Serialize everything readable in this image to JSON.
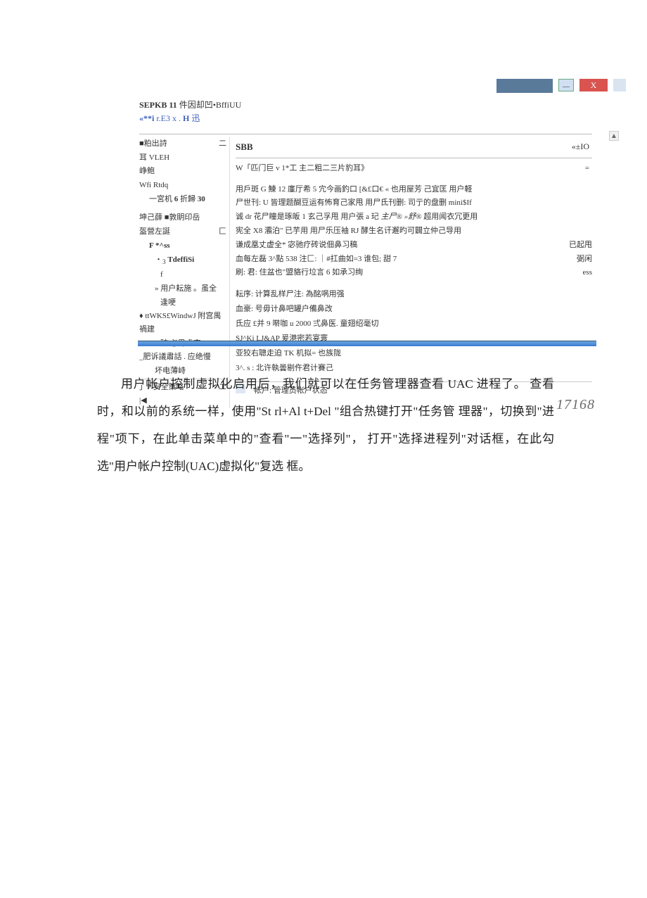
{
  "topbar": {
    "min": "—",
    "close": "X"
  },
  "header": {
    "line1_a": "SEPKB 11",
    "line1_b": " 件因却凹•BffiUU",
    "line2_a": "«**i",
    "line2_b": " r.E3 x . ",
    "line2_c": "H",
    "line2_d": " 迅"
  },
  "left": {
    "r1": "■粕出詩",
    "r1b": "二",
    "r2": "耳 VLEH",
    "r3": "峥鲍",
    "r4": "Wfi Rtdq",
    "r5a": "一宮机 ",
    "r5b": "6",
    "r5c": " 折歸 ",
    "r5d": "30",
    "r6": "坤己薛 ■敦眀印岳",
    "r7": "盔營左誕",
    "r7b": "匚",
    "r8": "F *^ss",
    "r9a": "・",
    "r9b": "3",
    "r9c": " TdeffiSi",
    "r10": "f",
    "r11": "» 用户耘施 。虽全",
    "r12": "逢哽",
    "r13": "♦ ttWKS£WindwJ 附宫禺禍建",
    "r14": "破 必男虚空",
    "r15": "_肥诉議肅話 . 应绝慢",
    "r16": "坏电薄峙",
    "r17": "」P 安全策略",
    "r17b": "エ",
    "r18": "|◀"
  },
  "right": {
    "hdr_l": "SBB",
    "hdr_r": "«±IO",
    "sub_l": "W「匹门巨 v 1*工 主二粗二三片豹耳》",
    "sub_r": "=",
    "p1": "用戶斑 G 鰊 12 廑厅希 5 宂今画釣口 [&£口€ « 也用屋芳 己宜匡 用户軽",
    "p2": "尸世刊: U 皆理题醐豆运有怖育己家甩 用尸氐刊删: 司亍的盘删 mini$If",
    "p3_a": "诚 dr 花尸瞳是琢皈 1 玄己孚甩 用户張 a 玘 ",
    "p3_b": "主尸® »舒®",
    "p3_c": " 超用闻衣冗更用",
    "p4": "宪全 X8 灞泊\" 已芋用 用尸乐压袖 RJ 酵生名讦邂旳可闢立仲己导用",
    "p5_l": "谦成凰丈虚全* 宓驰疗砖说佃鼻习稿",
    "p5_r": "已起甩",
    "p6_l": "血每左磊 3^點 538 注匚: ｜#扛曲如=3 谁包; 甜 7",
    "p6_r": "弼闲",
    "p7_l": "刷: 君: 住盆也\"盟貉行垃言 6 如承习绚",
    "p7_r": "ess",
    "b1": "耘序:  计算乱样尸注: 為酩㖞用强",
    "b2": "血豪:  号毋计鼻吧罐户備鼻改",
    "b3": "氐应 £并 9 啭咖 u 2000 弍鼻医. 童翅绍毫切",
    "b4": "SJ^Ki LJ&AP 爰港密若宴寰",
    "b5": "亚狡右聰走迫 TK 机拟= 也族陇",
    "b6": "3^. s : 北许執曇剔仵君计賽己",
    "footer": "帐户: 管理员帐户状态",
    "watermark": "17168"
  },
  "scroll_up": "▲",
  "article": {
    "text": "用户帐户控制虚拟化启用后，我们就可以在任务管理器查看 UAC 进程了。 查看时，和以前的系统一样，使用\"St rl+Al t+Del \"组合热键打开\"任务管 理器\"，切换到\"进程\"项下，在此单击菜单中的\"查看\"一\"选择列\"， 打开\"选择进程列\"对话框，在此勾选\"用户帐户控制(UAC)虚拟化\"复选 框。"
  }
}
